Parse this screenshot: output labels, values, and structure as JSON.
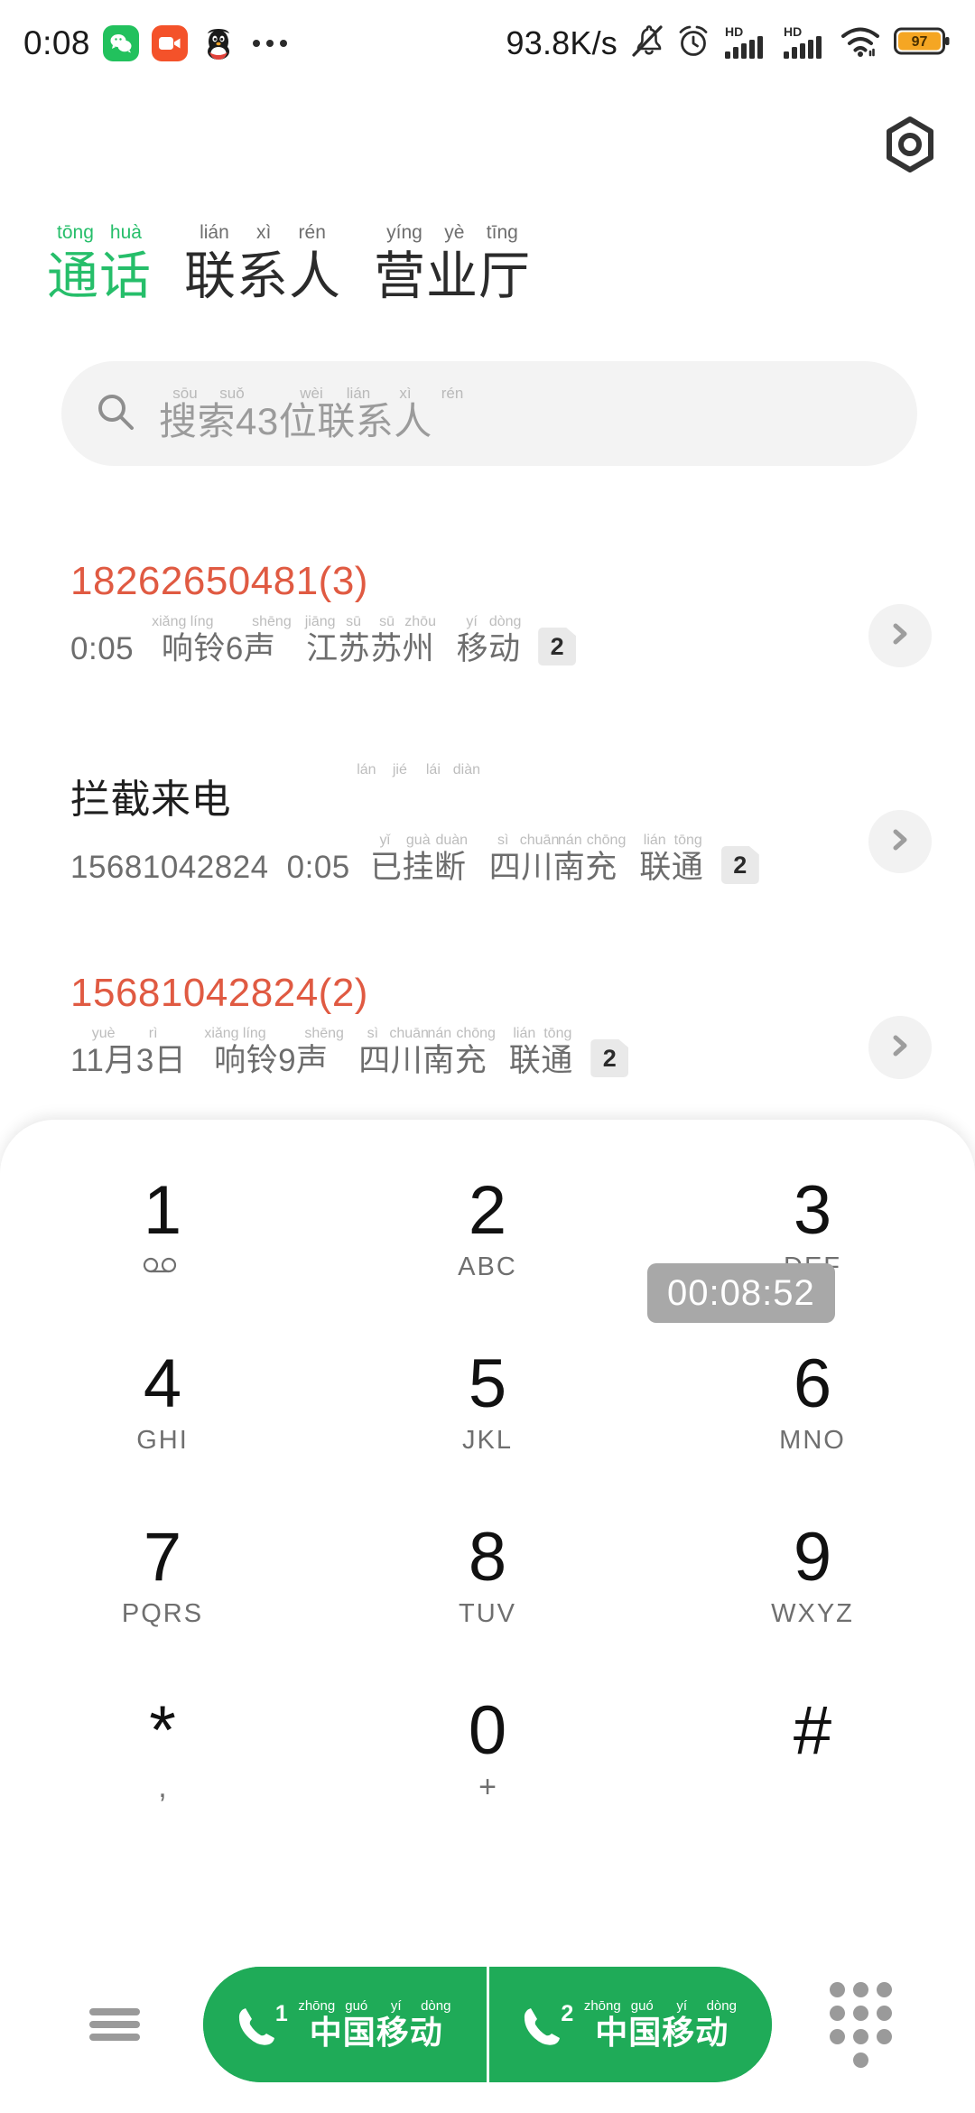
{
  "statusbar": {
    "clock": "0:08",
    "network_speed": "93.8K/s",
    "battery_level": "97",
    "icons": [
      "wechat-icon",
      "video-call-icon",
      "qq-penguin-icon",
      "more-dots-icon",
      "mute-bell-icon",
      "alarm-clock-icon",
      "hd-signal-1-icon",
      "hd-signal-2-icon",
      "wifi-icon",
      "battery-icon"
    ],
    "hd_label": "HD"
  },
  "header": {
    "settings_icon": "hex-nut-settings-icon"
  },
  "tabs": [
    {
      "han": "通话",
      "pinyin": [
        "tōng",
        "huà"
      ],
      "active": true
    },
    {
      "han": "联系人",
      "pinyin": [
        "lián",
        "xì",
        "rén"
      ],
      "active": false
    },
    {
      "han": "营业厅",
      "pinyin": [
        "yíng",
        "yè",
        "tīng"
      ],
      "active": false
    }
  ],
  "search": {
    "icon": "search-icon",
    "placeholder": "搜索43位联系人",
    "pinyin": [
      "sōu",
      "suǒ",
      "",
      "wèi",
      "lián",
      "xì",
      "rén"
    ]
  },
  "calls": [
    {
      "title": "18262650481(3)",
      "title_color": "red",
      "segments": [
        {
          "text": "0:05",
          "pinyin": []
        },
        {
          "text": "响铃6声",
          "pinyin": [
            "xiǎng",
            "líng",
            "",
            "shēng"
          ]
        },
        {
          "text": "江苏苏州",
          "pinyin": [
            "jiāng",
            "sū",
            "sū",
            "zhōu"
          ]
        },
        {
          "text": "移动",
          "pinyin": [
            "yí",
            "dòng"
          ]
        }
      ],
      "sim": "2",
      "chevron": "chevron-right-icon"
    },
    {
      "title": "拦截来电",
      "title_color": "dark",
      "title_pinyin": [
        "lán",
        "jié",
        "lái",
        "diàn"
      ],
      "segments": [
        {
          "text": "15681042824",
          "pinyin": []
        },
        {
          "text": "0:05",
          "pinyin": []
        },
        {
          "text": "已挂断",
          "pinyin": [
            "yǐ",
            "guà",
            "duàn"
          ]
        },
        {
          "text": "四川南充",
          "pinyin": [
            "sì",
            "chuān",
            "nán",
            "chōng"
          ]
        },
        {
          "text": "联通",
          "pinyin": [
            "lián",
            "tōng"
          ]
        }
      ],
      "sim": "2",
      "chevron": "chevron-right-icon"
    },
    {
      "title": "15681042824(2)",
      "title_color": "red",
      "segments": [
        {
          "text": "11月3日",
          "pinyin": [
            "yuè",
            "rì"
          ]
        },
        {
          "text": "响铃9声",
          "pinyin": [
            "xiǎng",
            "líng",
            "",
            "shēng"
          ]
        },
        {
          "text": "四川南充",
          "pinyin": [
            "sì",
            "chuān",
            "nán",
            "chōng"
          ]
        },
        {
          "text": "联通",
          "pinyin": [
            "lián",
            "tōng"
          ]
        }
      ],
      "sim": "2",
      "chevron": "chevron-right-icon"
    }
  ],
  "dialpad": {
    "keys": [
      {
        "num": "1",
        "sub": "",
        "sub_icon": "voicemail-icon"
      },
      {
        "num": "2",
        "sub": "ABC"
      },
      {
        "num": "3",
        "sub": "DEF"
      },
      {
        "num": "4",
        "sub": "GHI"
      },
      {
        "num": "5",
        "sub": "JKL"
      },
      {
        "num": "6",
        "sub": "MNO"
      },
      {
        "num": "7",
        "sub": "PQRS"
      },
      {
        "num": "8",
        "sub": "TUV"
      },
      {
        "num": "9",
        "sub": "WXYZ"
      },
      {
        "num": "*",
        "sub": ","
      },
      {
        "num": "0",
        "sub": "+"
      },
      {
        "num": "#",
        "sub": ""
      }
    ]
  },
  "timer": {
    "value": "00:08:52"
  },
  "bottombar": {
    "menu_icon": "hamburger-menu-icon",
    "keypad_icon": "keypad-dots-icon",
    "call_buttons": [
      {
        "han": "中国移动",
        "pinyin": [
          "zhōng",
          "guó",
          "yí",
          "dòng"
        ],
        "sim": "1",
        "icon": "phone-icon"
      },
      {
        "han": "中国移动",
        "pinyin": [
          "zhōng",
          "guó",
          "yí",
          "dòng"
        ],
        "sim": "2",
        "icon": "phone-icon"
      }
    ]
  },
  "colors": {
    "accent_green": "#26be6a",
    "call_button_green": "#1fab58",
    "missed_red": "#e05a42",
    "battery_amber": "#f5a623"
  }
}
